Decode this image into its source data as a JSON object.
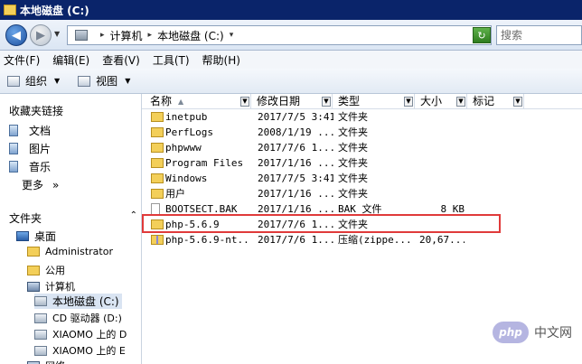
{
  "window": {
    "title": "本地磁盘 (C:)"
  },
  "address": {
    "crumbs": [
      "计算机",
      "本地磁盘 (C:)"
    ],
    "search_placeholder": "搜索"
  },
  "menu": [
    "文件(F)",
    "编辑(E)",
    "查看(V)",
    "工具(T)",
    "帮助(H)"
  ],
  "toolbar": {
    "organize": "组织",
    "views": "视图"
  },
  "nav": {
    "favorites_title": "收藏夹链接",
    "favorites": [
      "文档",
      "图片",
      "音乐"
    ],
    "more": "更多",
    "more_arrow": "»",
    "folders_title": "文件夹",
    "tree": [
      {
        "label": "桌面",
        "icon": "desktop-icon"
      },
      {
        "label": "Administrator",
        "icon": "user-folder-icon"
      },
      {
        "label": "公用",
        "icon": "folder-icon"
      },
      {
        "label": "计算机",
        "icon": "computer-icon"
      },
      {
        "label": "本地磁盘 (C:)",
        "icon": "hard-drive-icon"
      },
      {
        "label": "CD 驱动器 (D:)",
        "icon": "cd-drive-icon"
      },
      {
        "label": "XIAOMO 上的 D",
        "icon": "network-drive-icon"
      },
      {
        "label": "XIAOMO 上的 E",
        "icon": "network-drive-icon"
      },
      {
        "label": "网络",
        "icon": "network-icon"
      }
    ]
  },
  "columns": [
    "名称",
    "修改日期",
    "类型",
    "大小",
    "标记"
  ],
  "files": [
    {
      "name": "inetpub",
      "date": "2017/7/5 3:41",
      "type": "文件夹",
      "size": "",
      "icon": "folder-icon"
    },
    {
      "name": "PerfLogs",
      "date": "2008/1/19 ...",
      "type": "文件夹",
      "size": "",
      "icon": "folder-icon"
    },
    {
      "name": "phpwww",
      "date": "2017/7/6 1...",
      "type": "文件夹",
      "size": "",
      "icon": "folder-icon"
    },
    {
      "name": "Program Files",
      "date": "2017/1/16 ...",
      "type": "文件夹",
      "size": "",
      "icon": "folder-icon"
    },
    {
      "name": "Windows",
      "date": "2017/7/5 3:41",
      "type": "文件夹",
      "size": "",
      "icon": "folder-icon"
    },
    {
      "name": "用户",
      "date": "2017/1/16 ...",
      "type": "文件夹",
      "size": "",
      "icon": "folder-icon"
    },
    {
      "name": "BOOTSECT.BAK",
      "date": "2017/1/16 ...",
      "type": "BAK 文件",
      "size": "8 KB",
      "icon": "file-icon"
    },
    {
      "name": "php-5.6.9",
      "date": "2017/7/6 1...",
      "type": "文件夹",
      "size": "",
      "icon": "folder-icon"
    },
    {
      "name": "php-5.6.9-nt...",
      "date": "2017/7/6 1...",
      "type": "压缩(zippe...",
      "size": "20,67...",
      "icon": "zip-icon"
    }
  ],
  "watermark": {
    "logo": "php",
    "text": "中文网"
  }
}
